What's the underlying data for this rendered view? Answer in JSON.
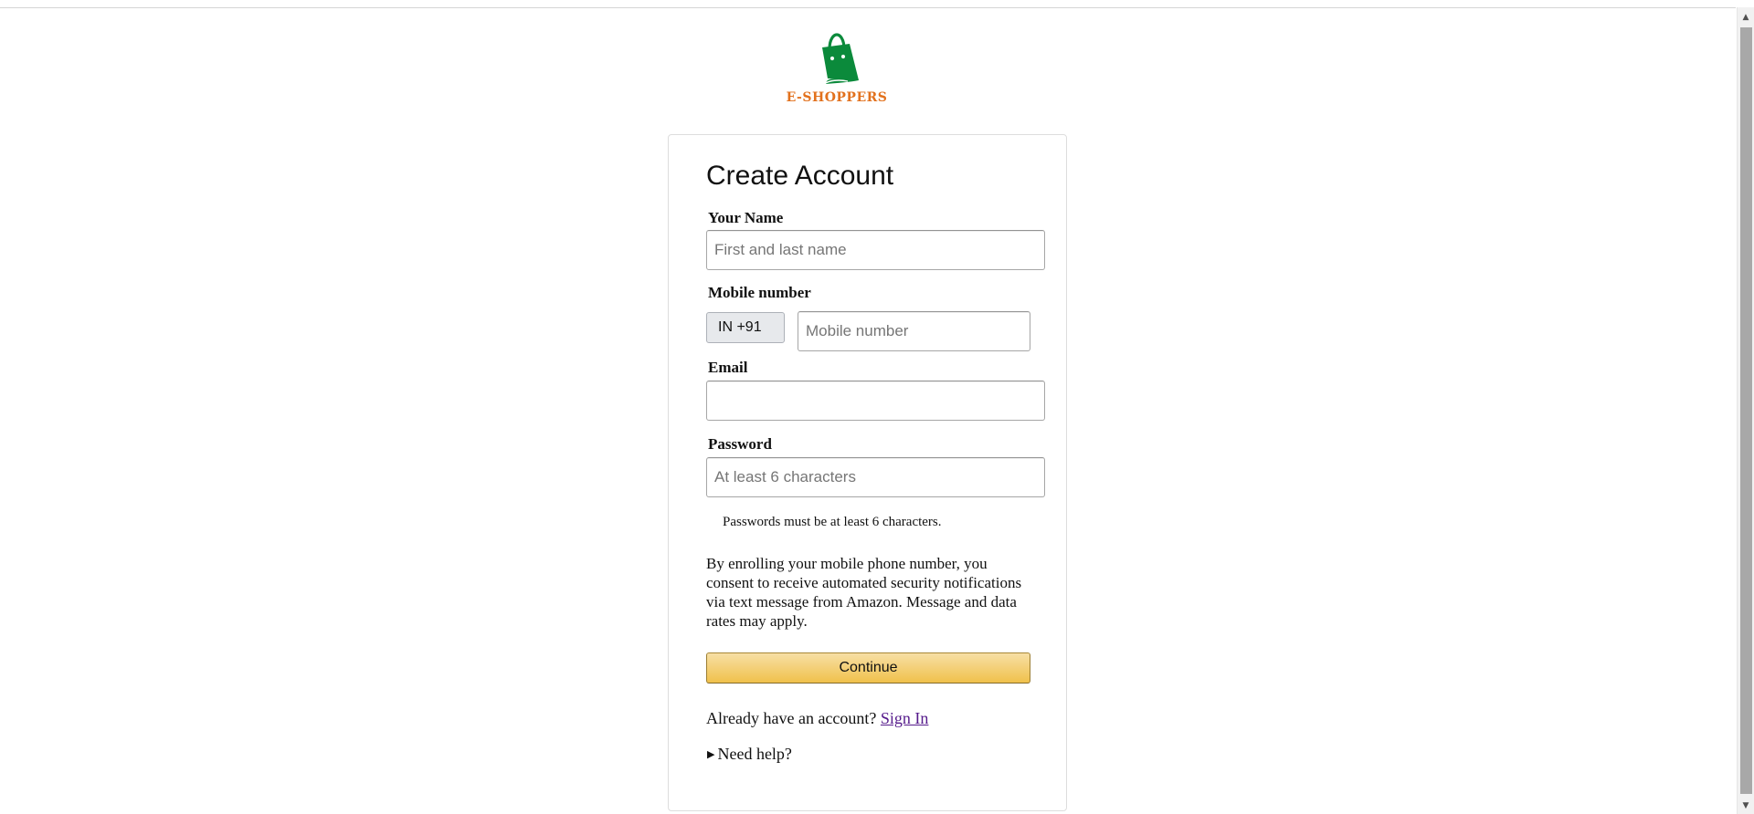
{
  "brand": {
    "name": "E-SHOPPERS",
    "icon": "shopping-bag-icon",
    "colors": {
      "bag": "#0b8a3b",
      "text": "#e2711d"
    }
  },
  "form": {
    "title": "Create Account",
    "name_label": "Your Name",
    "name_placeholder": "First and last name",
    "mobile_label": "Mobile number",
    "country_code": "IN +91",
    "mobile_placeholder": "Mobile number",
    "email_label": "Email",
    "email_placeholder": "",
    "password_label": "Password",
    "password_placeholder": "At least 6 characters",
    "password_hint": "Passwords must be at least 6 characters.",
    "consent_text": "By enrolling your mobile phone number, you consent to receive automated security notifications via text message from Amazon. Message and data rates may apply.",
    "continue_label": "Continue",
    "signin_prompt": "Already have an account?",
    "signin_link": "Sign In",
    "help_label": "Need help?",
    "help_icon": "caret-right-icon"
  },
  "colors": {
    "button": "#f0c14b",
    "link": "#551a8b"
  }
}
